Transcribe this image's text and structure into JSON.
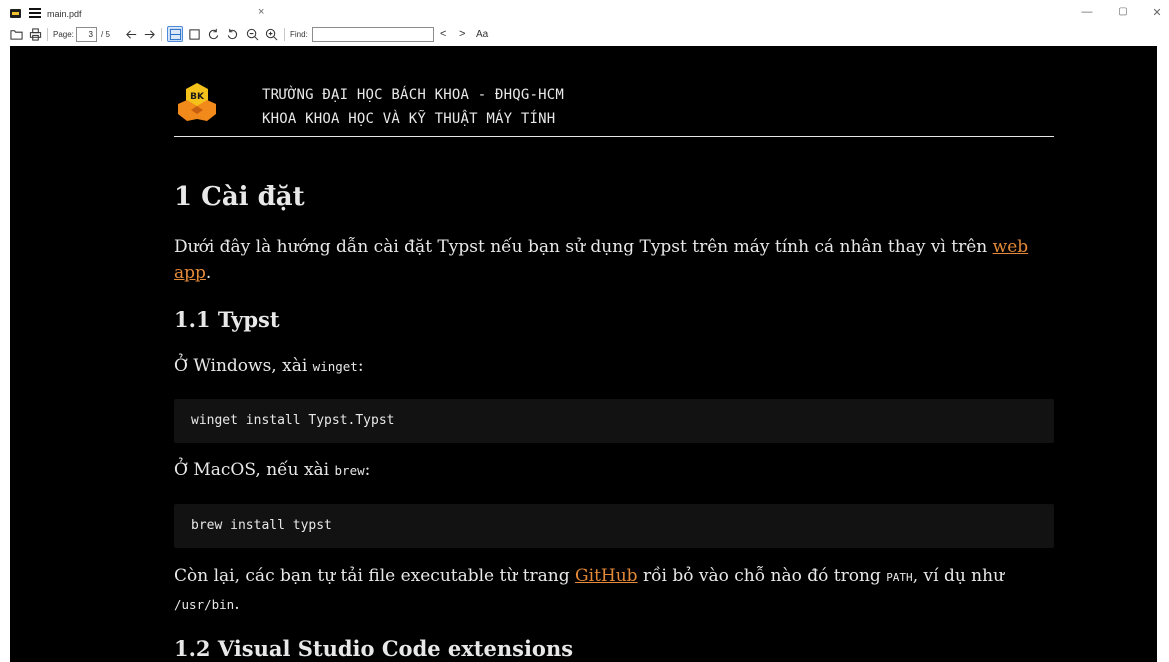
{
  "window": {
    "tab_title": "main.pdf",
    "tab_close": "×",
    "minimize": "—",
    "restore": "▢",
    "close": "✕"
  },
  "toolbar": {
    "page_label": "Page:",
    "page_value": "3",
    "page_total": "/ 5",
    "find_label": "Find:",
    "find_value": "",
    "prev_match": "<",
    "next_match": ">",
    "match_case": "Aa"
  },
  "document": {
    "header_line1": "TRƯỜNG ĐẠI HỌC BÁCH KHOA - ĐHQG-HCM",
    "header_line2": "KHOA KHOA HỌC VÀ KỸ THUẬT MÁY TÍNH",
    "logo_text": "BK",
    "section1_title": "1 Cài đặt",
    "intro_text": "Dưới đây là hướng dẫn cài đặt Typst nếu bạn sử dụng Typst trên máy tính cá nhân thay vì trên ",
    "intro_link": "web app",
    "intro_end": ".",
    "section11_title": "1.1 Typst",
    "windows_text": "Ở Windows, xài ",
    "windows_code": "winget",
    "windows_end": ":",
    "windows_command": "winget install Typst.Typst",
    "macos_text": "Ở MacOS, nếu xài ",
    "macos_code": "brew",
    "macos_end": ":",
    "macos_command": "brew install typst",
    "rest_text1": "Còn lại, các bạn tự tải file executable từ trang ",
    "rest_link": "GitHub",
    "rest_text2": " rồi bỏ vào chỗ nào đó trong ",
    "rest_code1": "PATH",
    "rest_text3": ", ví dụ như ",
    "rest_code2": "/usr/bin",
    "rest_end": ".",
    "section12_title": "1.2 Visual Studio Code extensions"
  },
  "colors": {
    "page_background": "#000000",
    "text": "#e8e8e8",
    "link": "#e58a38",
    "code_background": "#121212",
    "logo_orange": "#f28a1b",
    "logo_yellow": "#f5c21b"
  }
}
